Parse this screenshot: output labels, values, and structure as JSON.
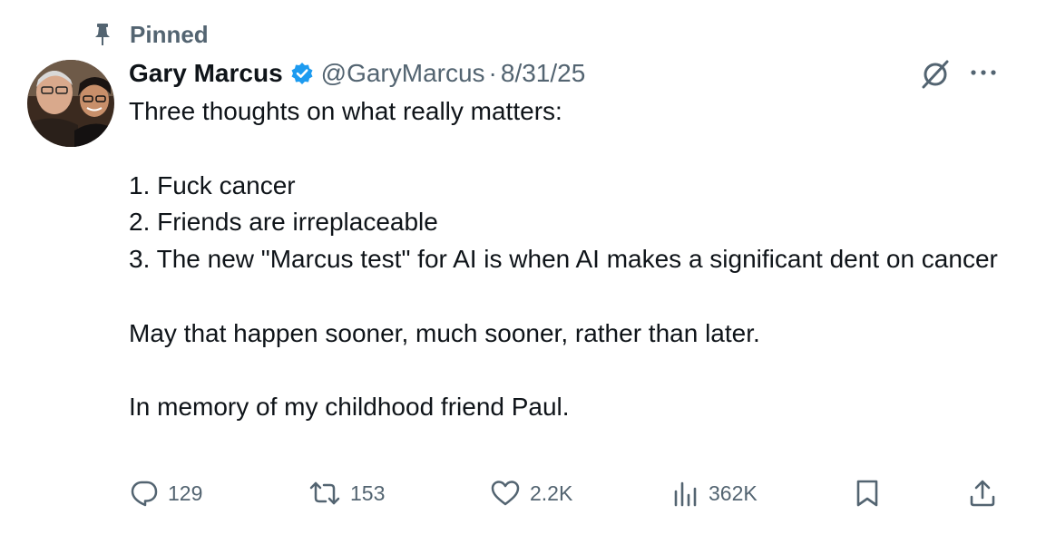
{
  "pinned": {
    "label": "Pinned",
    "icon": "pin-icon"
  },
  "author": {
    "name": "Gary Marcus",
    "handle": "@GaryMarcus",
    "separator": "·",
    "date": "8/31/25",
    "verified_color": "#1d9bf0"
  },
  "tweet": {
    "line1": "Three thoughts on what really matters:",
    "line2": "1. Fuck cancer",
    "line3": "2. Friends are irreplaceable",
    "line4": "3. The new \"Marcus test\" for AI is when AI makes a significant dent on cancer",
    "line5": "May that happen sooner, much sooner, rather than later.",
    "line6": "In memory of my childhood friend Paul."
  },
  "actions": {
    "replies": "129",
    "reposts": "153",
    "likes": "2.2K",
    "views": "362K"
  },
  "icons": [
    "pin-icon",
    "verified-icon",
    "grok-icon",
    "more-icon",
    "reply-icon",
    "repost-icon",
    "like-icon",
    "views-icon",
    "bookmark-icon",
    "share-icon"
  ],
  "colors": {
    "text": "#0f1419",
    "secondary": "#536471",
    "accent": "#1d9bf0"
  }
}
